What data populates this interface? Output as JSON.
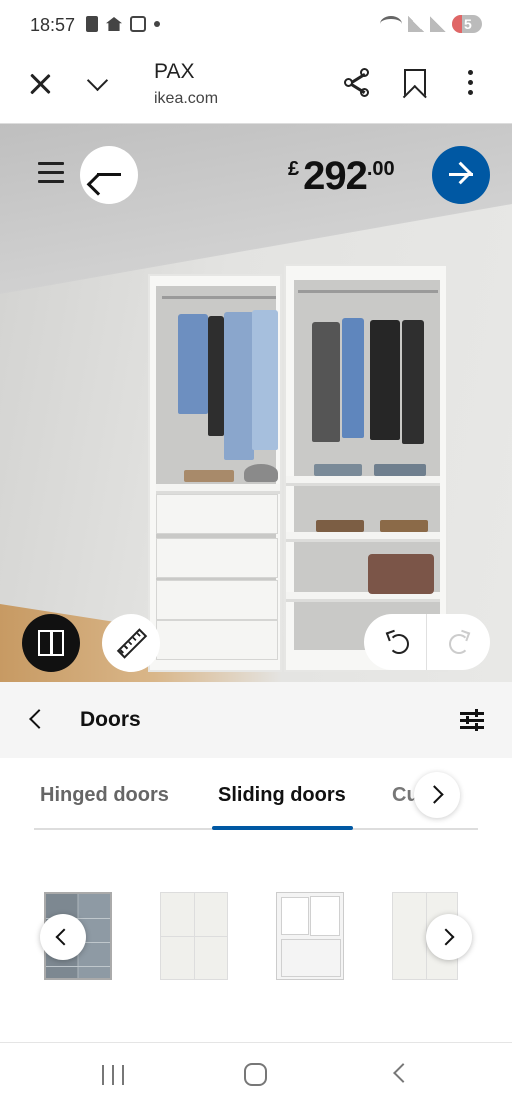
{
  "status_bar": {
    "time": "18:57",
    "battery_level": "5",
    "icons": [
      "notification-icon",
      "home-icon",
      "screenshot-icon",
      "dot-icon",
      "wifi-icon",
      "signal-icon",
      "signal-icon",
      "battery-icon"
    ]
  },
  "browser": {
    "title": "PAX",
    "url": "ikea.com",
    "icons": [
      "close-icon",
      "chevron-down-icon",
      "share-icon",
      "bookmark-icon",
      "more-vertical-icon"
    ]
  },
  "planner": {
    "price_currency": "£",
    "price_main": "292",
    "price_decimals": ".00",
    "accent_color": "#0058a3",
    "icons": [
      "menu-icon",
      "arrow-left-icon",
      "arrow-right-icon",
      "door-icon",
      "ruler-icon",
      "undo-icon",
      "redo-icon"
    ]
  },
  "panel": {
    "title": "Doors",
    "icons": [
      "chevron-left-icon",
      "filter-icon"
    ]
  },
  "tabs": [
    {
      "label": "Hinged doors",
      "active": false
    },
    {
      "label": "Sliding doors",
      "active": true
    },
    {
      "label": "Cu   n s",
      "active": false
    }
  ],
  "products": {
    "thumbnails": [
      "grey-glass-sliding-door",
      "white-panel-sliding-door",
      "white-glass-sliding-door",
      "white-plain-sliding-door"
    ]
  },
  "nav": {
    "icons": [
      "recents-icon",
      "home-icon",
      "back-icon"
    ]
  }
}
